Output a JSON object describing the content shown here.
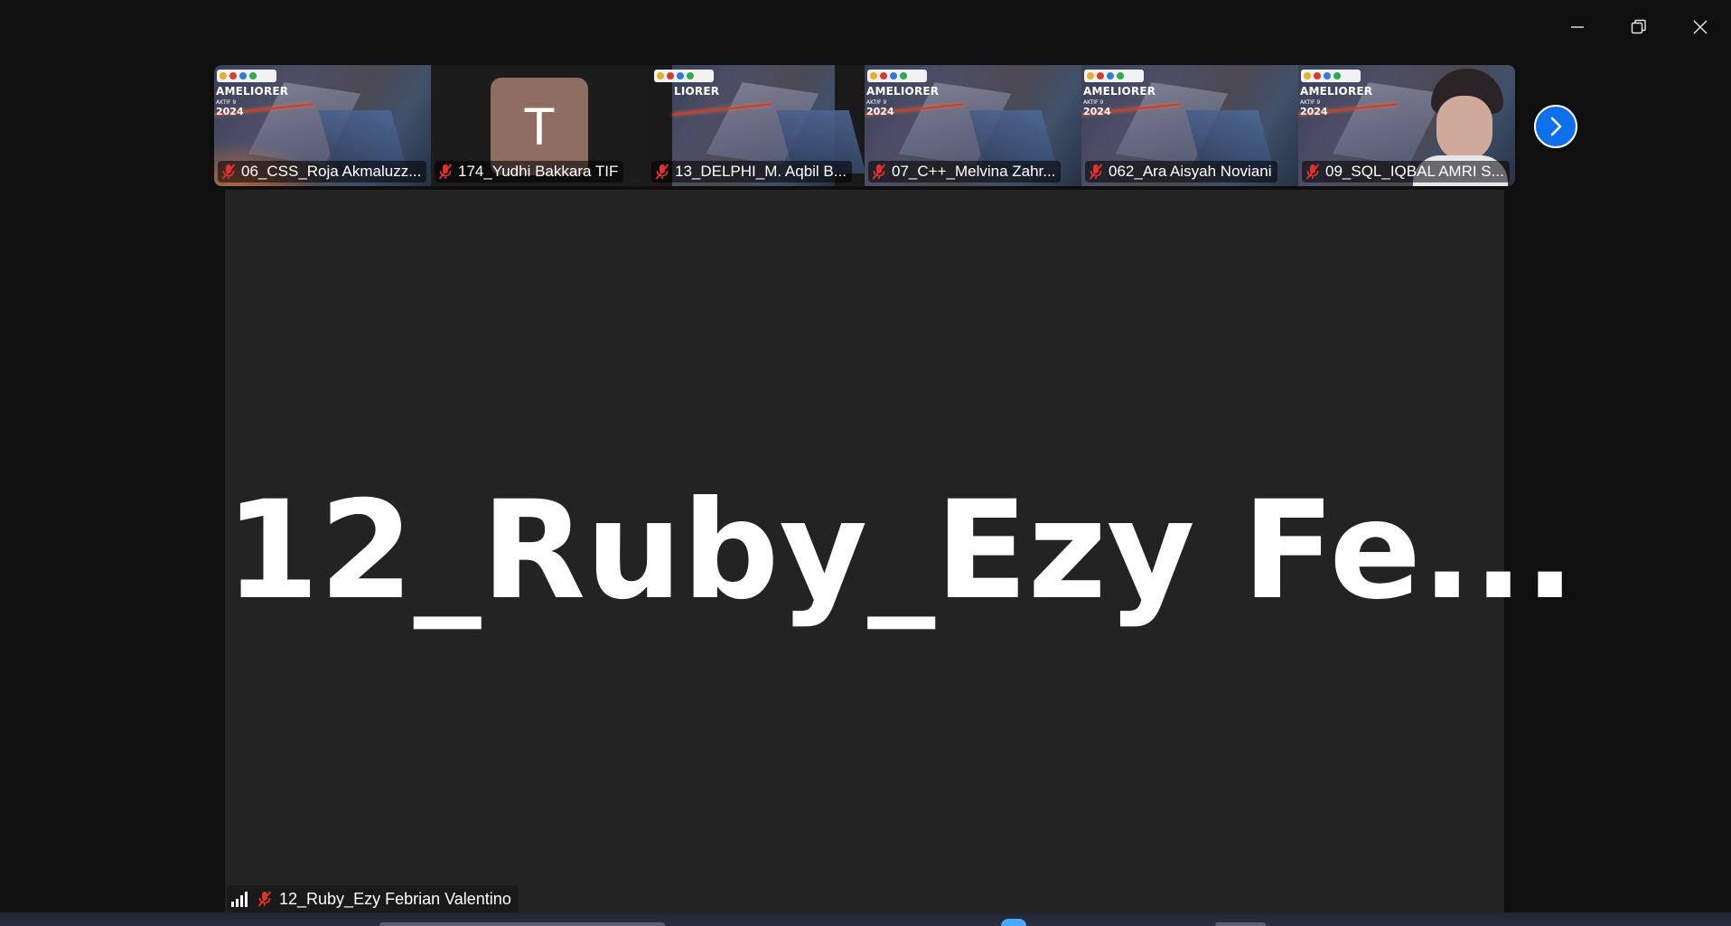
{
  "window": {
    "controls": [
      "minimize",
      "restore",
      "close"
    ]
  },
  "gallery": {
    "tiles": [
      {
        "name": "06_CSS_Roja Akmaluzz...",
        "type": "video",
        "muted": true,
        "poster_title": "AMELIORER",
        "poster_sub": "AKTIF 9",
        "poster_year": "2024"
      },
      {
        "name": "174_Yudhi Bakkara TIF",
        "type": "avatar",
        "muted": true,
        "initial": "T"
      },
      {
        "name": "13_DELPHI_M. Aqbil B...",
        "type": "video",
        "muted": true,
        "poster_title": "LIORER"
      },
      {
        "name": "07_C++_Melvina Zahr...",
        "type": "video",
        "muted": true,
        "poster_title": "AMELIORER",
        "poster_sub": "AKTIF 9",
        "poster_year": "2024"
      },
      {
        "name": "062_Ara Aisyah Noviani",
        "type": "video",
        "muted": true,
        "poster_title": "AMELIORER",
        "poster_sub": "AKTIF 9",
        "poster_year": "2024"
      },
      {
        "name": "09_SQL_IQBAL AMRI S...",
        "type": "video",
        "muted": true,
        "poster_title": "AMELIORER",
        "poster_sub": "AKTIF 9",
        "poster_year": "2024"
      }
    ],
    "next_icon": "chevron-right-icon"
  },
  "active_speaker": {
    "display_name": "12_Ruby_Ezy Fe...",
    "label": "12_Ruby_Ezy Febrian Valentino",
    "muted": true
  },
  "colors": {
    "background": "#0f0f10",
    "main_view": "#232323",
    "accent_blue": "#0e71eb",
    "mute_red": "#e0312b",
    "avatar": "#8e6e62"
  }
}
